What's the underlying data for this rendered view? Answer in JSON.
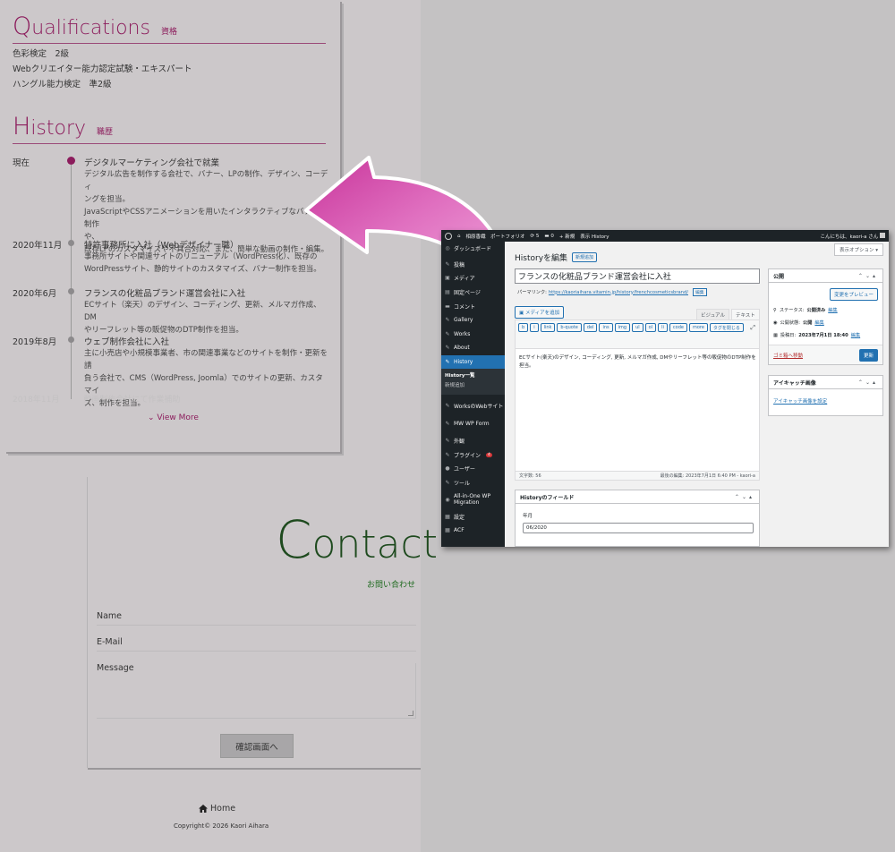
{
  "qualifications": {
    "title_cap": "Q",
    "title_rest": "ualifications",
    "subtitle": "資格",
    "items": [
      "色彩検定　2級",
      "Webクリエイター能力認定試験・エキスパート",
      "ハングル能力検定　準2級"
    ]
  },
  "history": {
    "title_cap": "H",
    "title_rest": "istory",
    "subtitle": "職歴",
    "entries": [
      {
        "date": "現在",
        "title": "デジタルマーケティング会社で就業",
        "lines": [
          "デジタル広告を制作する会社で、バナー、LPの制作、デザイン、コーディ",
          "ングを担当。",
          "JavaScriptやCSSアニメーションを用いたインタラクティブなバナーの制作",
          "や、",
          "既存LPのカスタマイズや不具合対応、また、簡単な動画の制作・編集。"
        ]
      },
      {
        "date": "2020年11月",
        "title": "特許事務所に入社（Webデザイナー職）",
        "lines": [
          "事務所サイトや関連サイトのリニューアル（WordPress化）、既存の",
          "WordPressサイト、静的サイトのカスタマイズ、バナー制作を担当。"
        ]
      },
      {
        "date": "2020年6月",
        "title": "フランスの化粧品ブランド運営会社に入社",
        "lines": [
          "ECサイト（楽天）のデザイン、コーディング、更新、メルマガ作成、DM",
          "やリーフレット等の販促物のDTP制作を担当。"
        ]
      },
      {
        "date": "2019年8月",
        "title": "ウェブ制作会社に入社",
        "lines": [
          "主に小売店や小規模事業者、市の関連事業などのサイトを制作・更新を請",
          "負う会社で、CMS（WordPress, Joomla）でのサイトの更新、カスタマイ",
          "ズ、制作を担当。"
        ]
      }
    ],
    "faded": "2018年11月　　　動画制作会社にて作業補助",
    "view_more": "View More"
  },
  "contact": {
    "title_cap": "C",
    "title_rest": "ontact",
    "subtitle": "お問い合わせ",
    "name_label": "Name",
    "email_label": "E-Mail",
    "message_label": "Message",
    "confirm_button": "確認画面へ"
  },
  "footer": {
    "home": "Home",
    "copyright": "Copyright© 2026 Kaori Aihara"
  },
  "wp": {
    "topbar": {
      "site": "相原香織　ポートフォリオ",
      "updates": "5",
      "comments": "0",
      "new": "新規",
      "view": "表示 History",
      "greeting": "こんにちは、kaori-a さん"
    },
    "screen_options": "表示オプション ▾",
    "menu": [
      {
        "icon": "◎",
        "label": "ダッシュボード"
      },
      {
        "icon": "✎",
        "label": "投稿"
      },
      {
        "icon": "▣",
        "label": "メディア"
      },
      {
        "icon": "▤",
        "label": "固定ページ"
      },
      {
        "icon": "▬",
        "label": "コメント"
      },
      {
        "icon": "✎",
        "label": "Gallery"
      },
      {
        "icon": "✎",
        "label": "Works"
      },
      {
        "icon": "✎",
        "label": "About"
      },
      {
        "icon": "✎",
        "label": "History"
      }
    ],
    "submenu": [
      "History一覧",
      "新規追加"
    ],
    "menu2": [
      {
        "icon": "✎",
        "label": "WorksのWebサイト"
      },
      {
        "icon": "✎",
        "label": "MW WP Form"
      },
      {
        "icon": "✎",
        "label": "外観"
      },
      {
        "icon": "✎",
        "label": "プラグイン",
        "badge": "4"
      },
      {
        "icon": "●",
        "label": "ユーザー"
      },
      {
        "icon": "✎",
        "label": "ツール"
      },
      {
        "icon": "◉",
        "label": "All-in-One WP Migration"
      },
      {
        "icon": "▦",
        "label": "設定"
      },
      {
        "icon": "▦",
        "label": "ACF"
      }
    ],
    "heading": "Historyを編集",
    "add_new": "新規追加",
    "post_title": "フランスの化粧品ブランド運営会社に入社",
    "permalink_label": "パーマリンク:",
    "permalink_url": "https://kaoriaihara.vitamin.jp/history/frenchcosmeticsbrand/",
    "permalink_edit": "編集",
    "add_media": "メディアを追加",
    "tab_visual": "ビジュアル",
    "tab_text": "テキスト",
    "quicktags": [
      "b",
      "i",
      "link",
      "b-quote",
      "del",
      "ins",
      "img",
      "ul",
      "ol",
      "li",
      "code",
      "more",
      "タグを閉じる"
    ],
    "content": "ECサイト(楽天)のデザイン, コーディング, 更新, メルマガ作成, DMやリーフレット等の販促物のDTP制作を担当。",
    "word_count": "文字数: 56",
    "last_edit": "最後の編集: 2023年7月1日 6:40 PM - kaori-a",
    "fields_title": "Historyのフィールド",
    "field_label": "年月",
    "field_value": "06/2020",
    "publish": {
      "title": "公開",
      "preview": "変更をプレビュー",
      "status_label": "ステータス:",
      "status_value": "公開済み",
      "status_link": "編集",
      "visibility_label": "公開状態:",
      "visibility_value": "公開",
      "visibility_link": "編集",
      "date_label": "投稿日:",
      "date_value": "2023年7月1日 18:40",
      "date_link": "編集",
      "trash": "ゴミ箱へ移動",
      "update": "更新"
    },
    "thumbnail": {
      "title": "アイキャッチ画像",
      "link": "アイキャッチ画像を設定"
    }
  }
}
